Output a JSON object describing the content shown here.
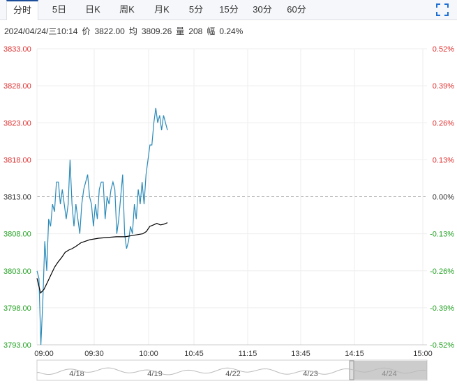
{
  "tabs": [
    "分时",
    "5日",
    "日K",
    "周K",
    "月K",
    "5分",
    "15分",
    "30分",
    "60分"
  ],
  "info": {
    "datetime": "2024/04/24/三10:14",
    "price_label": "价",
    "price": "3822.00",
    "avg_label": "均",
    "avg": "3809.26",
    "vol_label": "量",
    "vol": "208",
    "chg_label": "幅",
    "chg": "0.24%"
  },
  "colors": {
    "price_line": "#2a8ab8",
    "avg_line": "#000000",
    "up": "#e03030",
    "down": "#21a021",
    "axis_text": "#333333"
  },
  "chart_data": {
    "type": "line",
    "prev_close": 3813.0,
    "ylim": [
      3793.0,
      3833.0
    ],
    "y_ticks": [
      "3833.00",
      "3828.00",
      "3823.00",
      "3818.00",
      "3813.00",
      "3808.00",
      "3803.00",
      "3798.00",
      "3793.00"
    ],
    "pct_ticks": [
      "0.52%",
      "0.39%",
      "0.26%",
      "0.13%",
      "0.00%",
      "-0.13%",
      "-0.26%",
      "-0.39%",
      "-0.52%"
    ],
    "x_ticks": [
      "09:00",
      "09:30",
      "10:00",
      "10:45",
      "11:15",
      "13:45",
      "14:15",
      "15:00"
    ],
    "grid": true,
    "series": [
      {
        "role": "price",
        "minutes": [
          0,
          1,
          2,
          3,
          4,
          5,
          6,
          7,
          8,
          9,
          10,
          11,
          12,
          13,
          14,
          15,
          16,
          17,
          18,
          19,
          20,
          21,
          22,
          23,
          24,
          25,
          26,
          27,
          28,
          29,
          30,
          31,
          32,
          33,
          34,
          35,
          36,
          37,
          38,
          39,
          40,
          41,
          42,
          43,
          44,
          45,
          46,
          47,
          48,
          49,
          50,
          51,
          52,
          53,
          54,
          55,
          56,
          57,
          58,
          59,
          60,
          61,
          62,
          63,
          64,
          65,
          66,
          67,
          68,
          69,
          70,
          71,
          72,
          73,
          74
        ],
        "values": [
          3803,
          3802,
          3793,
          3799,
          3807,
          3803,
          3810,
          3809,
          3812,
          3811,
          3815,
          3815,
          3812,
          3814,
          3812,
          3810,
          3812,
          3818,
          3812,
          3809,
          3812,
          3810,
          3808,
          3812,
          3814,
          3815,
          3816,
          3813,
          3812,
          3809,
          3812,
          3810,
          3814,
          3815,
          3815,
          3810,
          3813,
          3812,
          3814,
          3815,
          3814,
          3808,
          3810,
          3813,
          3816,
          3808,
          3806,
          3807,
          3809,
          3808,
          3812,
          3810,
          3814,
          3812,
          3815,
          3812,
          3816,
          3818,
          3820,
          3820,
          3823,
          3825,
          3823,
          3824,
          3822,
          3824,
          3823,
          3822
        ],
        "name": ""
      },
      {
        "role": "average",
        "minutes": [
          0,
          2,
          4,
          6,
          8,
          10,
          12,
          14,
          16,
          18,
          20,
          22,
          25,
          30,
          35,
          40,
          45,
          50,
          55,
          60,
          62,
          64,
          66,
          68,
          70,
          72,
          74
        ],
        "values": [
          3802,
          3800,
          3800.5,
          3801.5,
          3802.5,
          3803.5,
          3804.2,
          3804.8,
          3805.5,
          3805.8,
          3806,
          3806.3,
          3806.8,
          3807.2,
          3807.4,
          3807.5,
          3807.6,
          3807.6,
          3807.8,
          3808,
          3808.3,
          3809,
          3809.2,
          3809.4,
          3809.2,
          3809.3,
          3809.5
        ],
        "name": ""
      }
    ]
  },
  "navigator": {
    "labels": [
      "4/18",
      "4/19",
      "4/22",
      "4/23",
      "4/24"
    ]
  }
}
